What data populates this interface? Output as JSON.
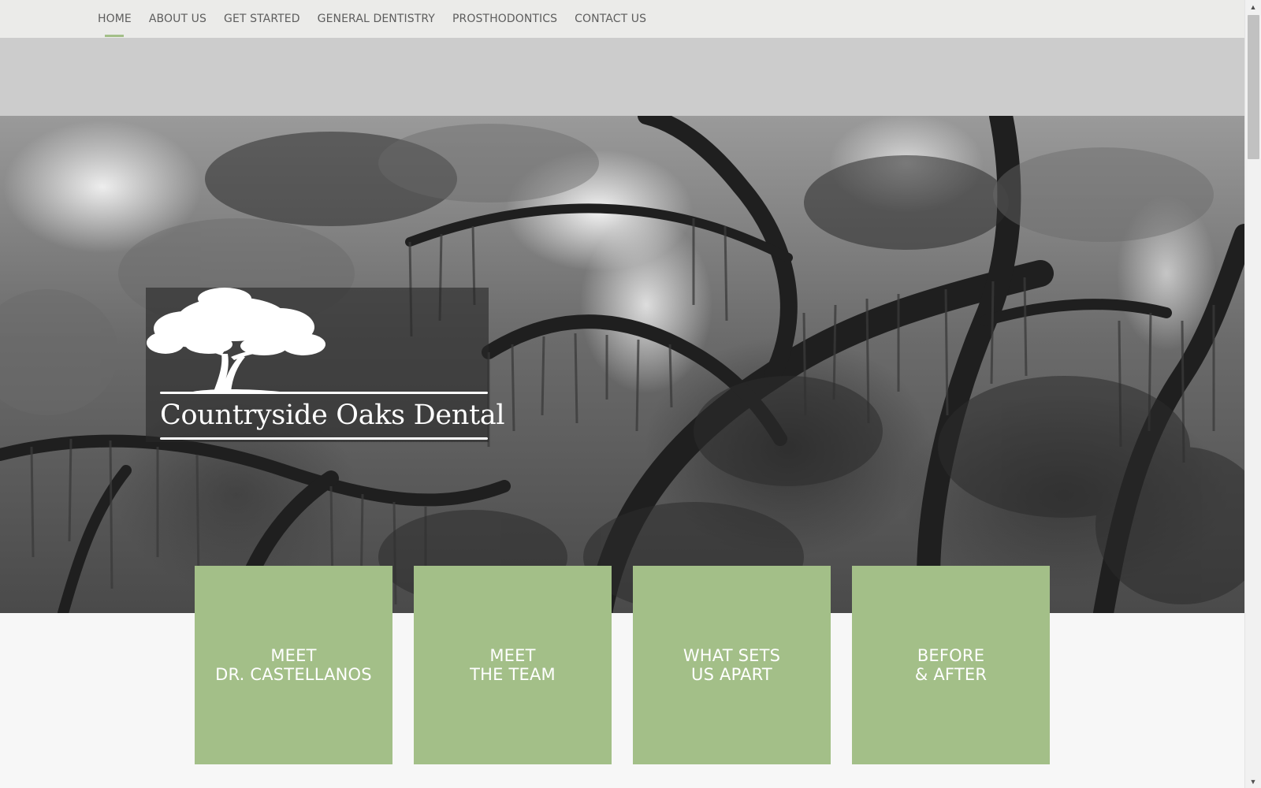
{
  "nav": {
    "items": [
      {
        "label": "HOME",
        "active": true
      },
      {
        "label": "ABOUT US",
        "active": false
      },
      {
        "label": "GET STARTED",
        "active": false
      },
      {
        "label": "GENERAL DENTISTRY",
        "active": false
      },
      {
        "label": "PROSTHODONTICS",
        "active": false
      },
      {
        "label": "CONTACT US",
        "active": false
      }
    ]
  },
  "hero": {
    "logo_text": "Countryside Oaks Dental"
  },
  "tiles": [
    {
      "line1": "MEET",
      "line2": "DR. CASTELLANOS"
    },
    {
      "line1": "MEET",
      "line2": "THE TEAM"
    },
    {
      "line1": "WHAT SETS",
      "line2": "US APART"
    },
    {
      "line1": "BEFORE",
      "line2": "& AFTER"
    }
  ],
  "colors": {
    "accent": "#a3bf88",
    "nav_bg": "#ebebe9",
    "band": "#cccccc",
    "nav_text": "#5d5d5d"
  },
  "scrollbar": {
    "up_icon": "triangle-up",
    "down_icon": "triangle-down"
  }
}
